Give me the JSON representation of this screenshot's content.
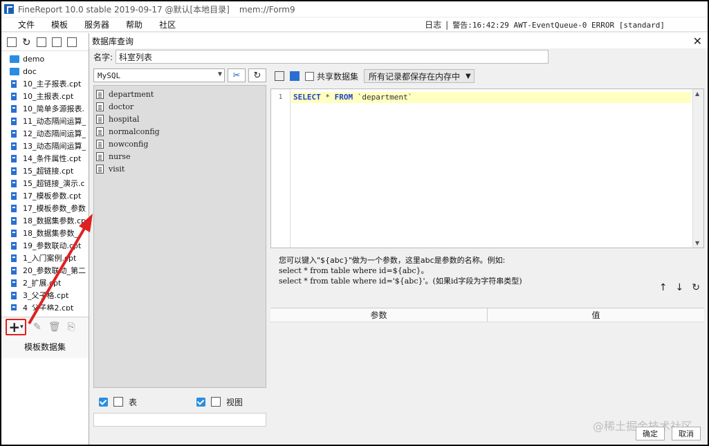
{
  "window": {
    "title": "FineReport 10.0 stable 2019-09-17 @默认[本地目录]",
    "memo": "mem://Form9"
  },
  "menu": [
    "文件",
    "模板",
    "服务器",
    "帮助",
    "社区"
  ],
  "status": {
    "log": "日志",
    "warn": "警告:16:42:29 AWT-EventQueue-0 ERROR [standard]"
  },
  "tree": [
    {
      "type": "folder",
      "label": "demo"
    },
    {
      "type": "folder",
      "label": "doc"
    },
    {
      "type": "file",
      "label": "10_主子报表.cpt"
    },
    {
      "type": "file",
      "label": "10_主报表.cpt"
    },
    {
      "type": "file",
      "label": "10_简单多源报表."
    },
    {
      "type": "file",
      "label": "11_动态隔间运算_"
    },
    {
      "type": "file",
      "label": "12_动态隔间运算_"
    },
    {
      "type": "file",
      "label": "13_动态隔间运算_"
    },
    {
      "type": "file",
      "label": "14_条件属性.cpt"
    },
    {
      "type": "file",
      "label": "15_超链接.cpt"
    },
    {
      "type": "file",
      "label": "15_超链接_演示.c"
    },
    {
      "type": "file",
      "label": "17_模板参数.cpt"
    },
    {
      "type": "file",
      "label": "17_模板参数_参数"
    },
    {
      "type": "file",
      "label": "18_数据集参数.cp"
    },
    {
      "type": "file",
      "label": "18_数据集参数_"
    },
    {
      "type": "file",
      "label": "19_参数联动.cpt"
    },
    {
      "type": "file",
      "label": "1_入门案例.cpt"
    },
    {
      "type": "file",
      "label": "20_参数联动_第二"
    },
    {
      "type": "file",
      "label": "2_扩展.cpt"
    },
    {
      "type": "file",
      "label": "3_父子格.cpt"
    },
    {
      "type": "file",
      "label": "4_父子格2.cpt"
    }
  ],
  "left_bottom": {
    "label": "模板数据集"
  },
  "dialog": {
    "title": "数据库查询",
    "close": "✕",
    "name_label": "名字:",
    "name_value": "科室列表",
    "db_select": "MySQL",
    "tables": [
      "department",
      "doctor",
      "hospital",
      "normalconfig",
      "nowconfig",
      "nurse",
      "visit"
    ],
    "chk_table": "表",
    "chk_view": "视图",
    "shared_label": "共享数据集",
    "memory_select": "所有记录都保存在内存中",
    "line_number": "1",
    "sql": {
      "kw1": "SELECT",
      "star": " * ",
      "kw2": "FROM",
      "table": " `department`"
    },
    "help": {
      "line1": "您可以键入\"${abc}\"做为一个参数，这里abc是参数的名称。例如:",
      "line2": "select * from table where id=${abc}。",
      "line3": "select * from table where id='${abc}'。(如果id字段为字符串类型)"
    },
    "param_header": [
      "参数",
      "值"
    ],
    "ok": "确定",
    "cancel": "取消"
  },
  "watermark": "@稀土掘金技术社区",
  "colors": {
    "accent": "#2a8ee0",
    "highlight": "#ffffc0",
    "keyword": "#1f3fd0",
    "arrow": "#e02020"
  }
}
